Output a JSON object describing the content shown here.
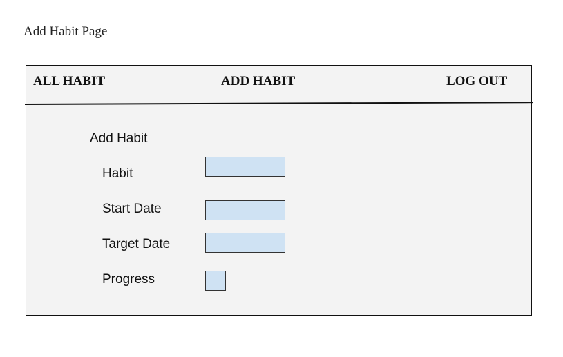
{
  "page": {
    "caption": "Add Habit Page"
  },
  "nav": {
    "all_habit": "ALL HABIT",
    "add_habit": "ADD HABIT",
    "log_out": "LOG OUT"
  },
  "form": {
    "title": "Add Habit",
    "fields": [
      {
        "label": "Habit",
        "value": ""
      },
      {
        "label": "Start Date",
        "value": ""
      },
      {
        "label": "Target Date",
        "value": ""
      },
      {
        "label": "Progress",
        "value": ""
      }
    ]
  },
  "colors": {
    "panel_background": "#f3f3f3",
    "input_fill": "#cfe2f3",
    "border": "#111111"
  }
}
